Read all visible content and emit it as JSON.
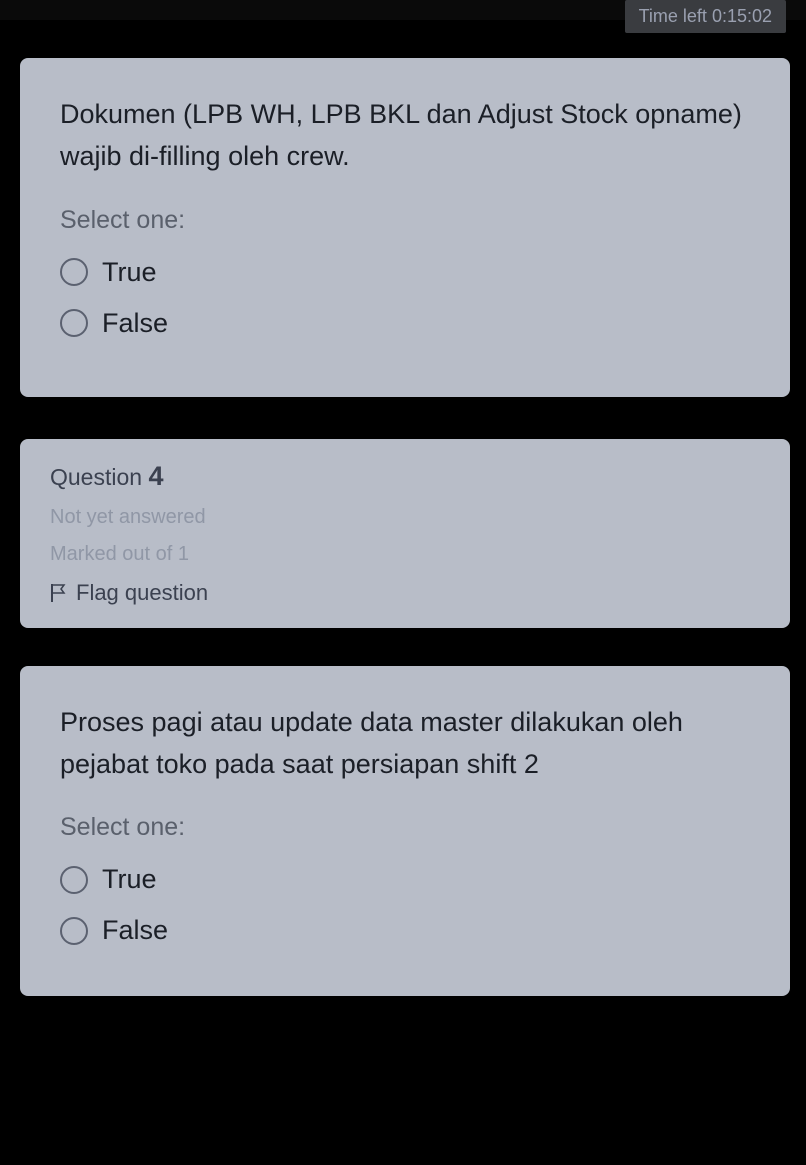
{
  "timer": {
    "label": "Time left 0:15:02"
  },
  "question3": {
    "text": "Dokumen (LPB WH, LPB BKL dan Adjust Stock opname) wajib di-filling oleh crew.",
    "select_one": "Select one:",
    "options": {
      "true": "True",
      "false": "False"
    }
  },
  "question4_meta": {
    "label": "Question",
    "number": "4",
    "status": "Not yet answered",
    "marked": "Marked out of 1",
    "flag": "Flag question"
  },
  "question4": {
    "text": "Proses pagi atau update data master dilakukan oleh pejabat toko pada saat persiapan shift 2",
    "select_one": "Select one:",
    "options": {
      "true": "True",
      "false": "False"
    }
  }
}
